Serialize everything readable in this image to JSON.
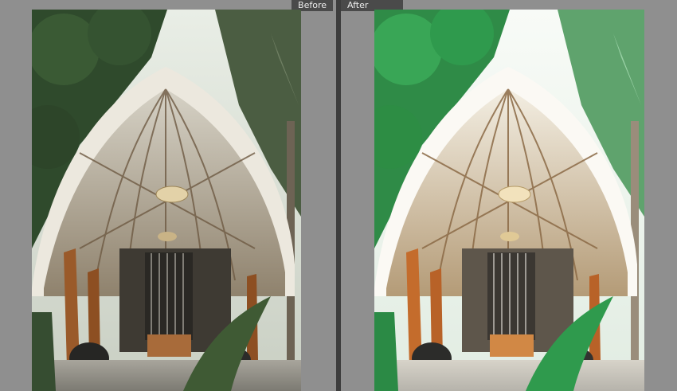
{
  "before": {
    "label": "Before"
  },
  "after": {
    "label": "After"
  },
  "colors": {
    "background": "#8f8f8f",
    "divider": "#3d3d3d",
    "label_bg": "#4a4a4a",
    "label_text": "#ececec"
  },
  "icons": [
    "photo-before",
    "photo-after"
  ]
}
